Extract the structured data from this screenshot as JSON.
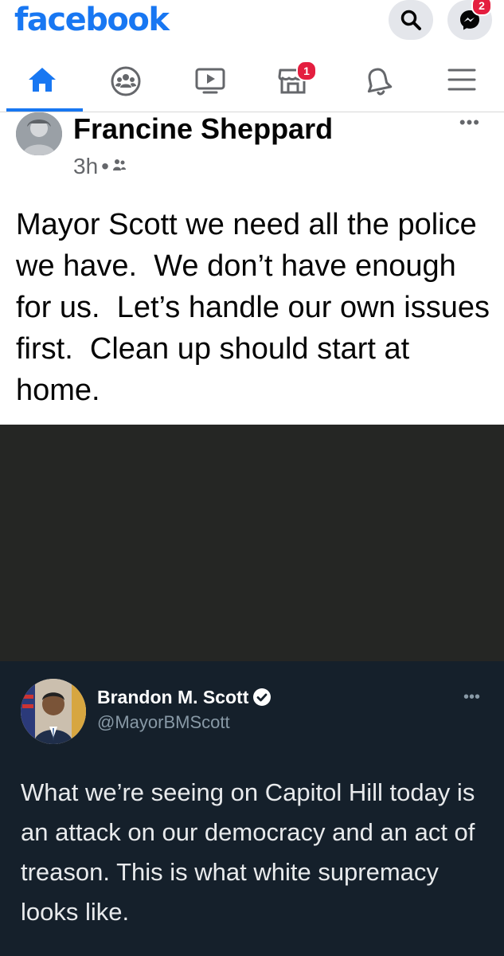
{
  "app": {
    "logo": "facebook",
    "brand_color": "#1877f2"
  },
  "header": {
    "search_icon": "search-icon",
    "messenger_icon": "messenger-icon",
    "messenger_badge": "2"
  },
  "nav": {
    "items": [
      {
        "name": "home",
        "icon": "home-icon",
        "active": true
      },
      {
        "name": "groups",
        "icon": "groups-icon"
      },
      {
        "name": "watch",
        "icon": "video-icon"
      },
      {
        "name": "marketplace",
        "icon": "marketplace-icon",
        "badge": "1"
      },
      {
        "name": "notifications",
        "icon": "bell-icon"
      },
      {
        "name": "menu",
        "icon": "hamburger-menu-icon"
      }
    ]
  },
  "post": {
    "author": "Francine Sheppard",
    "time": "3h",
    "audience_icon": "friends-icon",
    "more": "•••",
    "text": "Mayor Scott we need all the police we have.  We don’t have enough for us.  Let’s handle our own issues first.  Clean up should start at home."
  },
  "tweet": {
    "name": "Brandon M. Scott",
    "handle": "@MayorBMScott",
    "more": "•••",
    "text": "What we’re seeing on Capitol Hill today is an attack on our democracy and an act of treason. This is what white supremacy looks like."
  }
}
